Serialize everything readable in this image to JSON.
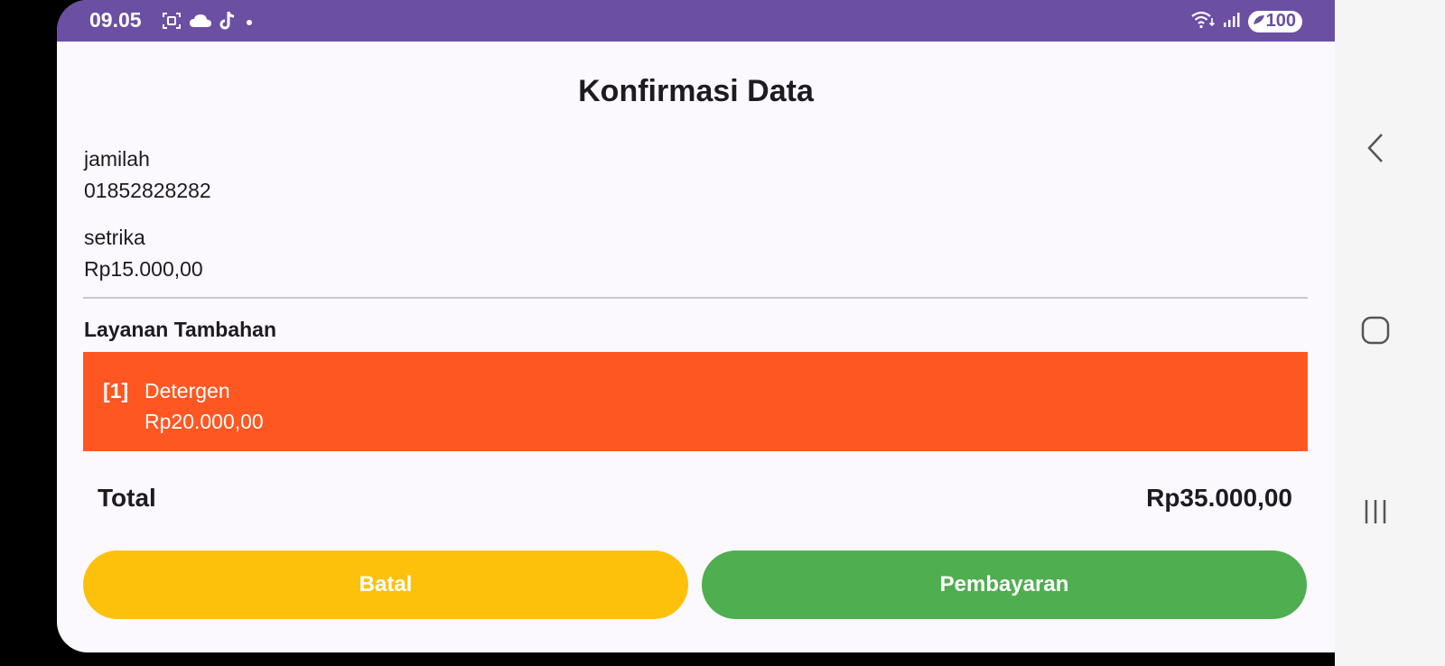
{
  "status_bar": {
    "time": "09.05",
    "battery": "100",
    "icons_left": [
      "screenshot-icon",
      "cloud-icon",
      "tiktok-icon",
      "dot-icon"
    ],
    "icons_right": [
      "wifi-icon",
      "signal-icon",
      "battery-icon"
    ]
  },
  "page": {
    "title": "Konfirmasi Data"
  },
  "customer": {
    "name": "jamilah",
    "phone": "01852828282"
  },
  "service": {
    "name": "setrika",
    "price": "Rp15.000,00"
  },
  "addons": {
    "title": "Layanan Tambahan",
    "items": [
      {
        "index": "[1]",
        "name": "Detergen",
        "price": "Rp20.000,00"
      }
    ]
  },
  "summary": {
    "total_label": "Total",
    "total_value": "Rp35.000,00"
  },
  "actions": {
    "cancel_label": "Batal",
    "pay_label": "Pembayaran"
  },
  "colors": {
    "status_bar": "#6a4fa3",
    "addon_card": "#ff5722",
    "cancel_button": "#fdc10b",
    "pay_button": "#4fae50"
  },
  "navigation": {
    "icons": [
      "back-icon",
      "home-icon",
      "recents-icon"
    ]
  }
}
